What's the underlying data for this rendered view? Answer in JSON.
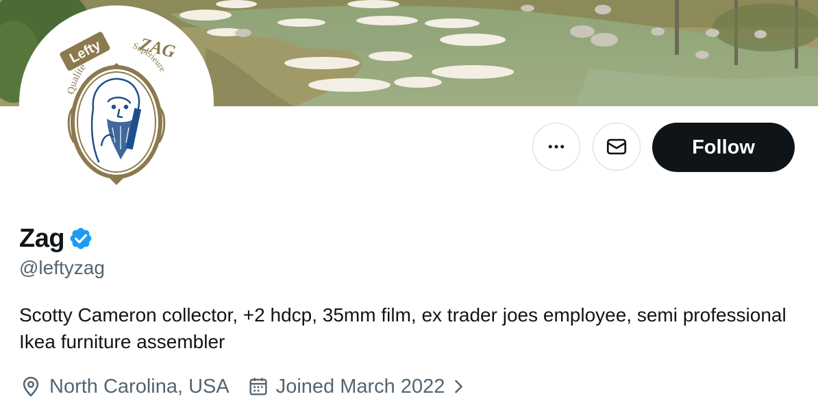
{
  "profile": {
    "display_name": "Zag",
    "handle": "@leftyzag",
    "bio": "Scotty Cameron collector, +2 hdcp, 35mm film, ex trader joes employee, semi professional Ikea furniture assembler",
    "location": "North Carolina, USA",
    "joined": "Joined March 2022",
    "verified": true
  },
  "actions": {
    "more_icon": "more-horizontal-icon",
    "message_icon": "envelope-icon",
    "follow_label": "Follow"
  },
  "avatar_logo": {
    "badge_text": "Lefty",
    "brand_text": "ZAG",
    "left_arc_text": "Qualite",
    "right_arc_text": "Superieure"
  },
  "icons": {
    "location": "location-pin-icon",
    "calendar": "calendar-icon",
    "chevron": "chevron-right-icon",
    "verified": "verified-badge-icon"
  },
  "colors": {
    "follow_bg": "#0f1419",
    "follow_text": "#ffffff",
    "verified_blue": "#1d9bf0",
    "secondary_text": "#536471",
    "border": "#cfd9de",
    "logo_brown": "#8b7a4e",
    "logo_blue": "#1f4e8c"
  }
}
